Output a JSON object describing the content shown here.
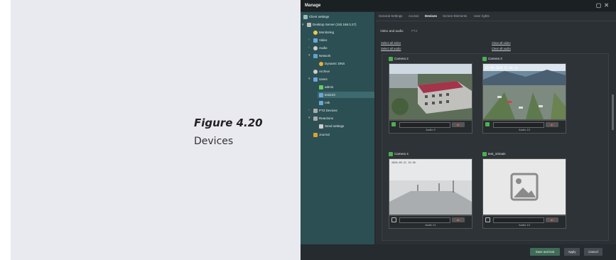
{
  "figure": {
    "title": "Figure 4.20",
    "subtitle": "Devices"
  },
  "window": {
    "title": "Manage"
  },
  "tree": {
    "client_settings": "Client settings",
    "server": "Desktop Server (192.168.0.27)",
    "monitoring": "Monitoring",
    "video": "Video",
    "audio": "Audio",
    "network": "Network",
    "dynamic_dns": "Dynamic DNS",
    "archive": "Archive",
    "users": "Users",
    "admin": "admin",
    "user_selected": "test123",
    "user3": "rnik",
    "ptz": "PTZ Devices",
    "reactions": "Reactions",
    "send_settings": "Send settings",
    "journal": "Journal"
  },
  "tabs": [
    "General Settings",
    "Access",
    "Devices",
    "Screen Elements",
    "User rights"
  ],
  "subtabs": {
    "active": "Video and audio",
    "other": "PTZ"
  },
  "links": {
    "select_all_video": "Select all video",
    "clear_all_video": "Clear all video",
    "select_all_audio": "Select all audio",
    "clear_all_audio": "Clear all audio"
  },
  "cameras": [
    {
      "name": "Camera 2",
      "checked": true,
      "audio": "Audio 9",
      "audio_checked": true
    },
    {
      "name": "Camera 3",
      "checked": true,
      "audio": "Audio 10",
      "audio_checked": true
    },
    {
      "name": "Camera 4",
      "checked": true,
      "audio": "Audio 11",
      "audio_checked": false
    },
    {
      "name": "test_10main",
      "checked": true,
      "audio": "Audio 12",
      "audio_checked": false
    }
  ],
  "buttons": {
    "save_exit": "Save and Exit",
    "apply": "Apply",
    "cancel": "Cancel"
  },
  "colors": {
    "tree_bg": "#2c4f53",
    "accent_green": "#4caf50",
    "save_button": "#3f6b57"
  }
}
